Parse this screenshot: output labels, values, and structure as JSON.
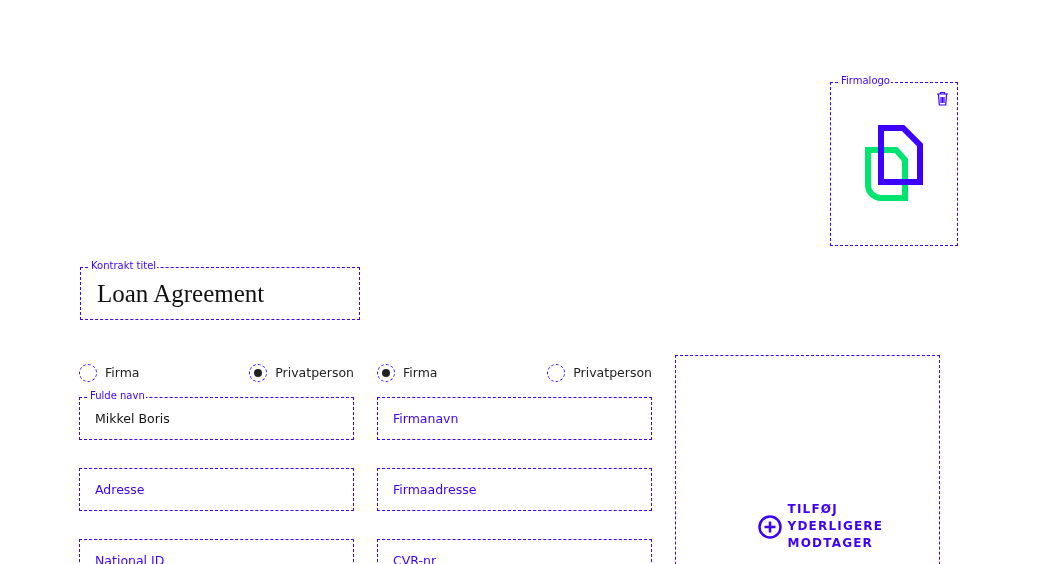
{
  "logo_box": {
    "label": "Firmalogo"
  },
  "contract_title": {
    "label": "Kontrakt titel",
    "value": "Loan Agreement"
  },
  "parties": [
    {
      "options": [
        {
          "label": "Firma",
          "selected": false
        },
        {
          "label": "Privatperson",
          "selected": true
        }
      ],
      "fields": [
        {
          "label": "Fulde navn",
          "value": "Mikkel Boris"
        },
        {
          "placeholder": "Adresse"
        },
        {
          "placeholder": "National ID"
        }
      ]
    },
    {
      "options": [
        {
          "label": "Firma",
          "selected": true
        },
        {
          "label": "Privatperson",
          "selected": false
        }
      ],
      "fields": [
        {
          "placeholder": "Firmanavn"
        },
        {
          "placeholder": "Firmaadresse"
        },
        {
          "placeholder": "CVR-nr"
        }
      ]
    }
  ],
  "add_recipient": {
    "label": "TILFØJ YDERLIGERE MODTAGER"
  }
}
